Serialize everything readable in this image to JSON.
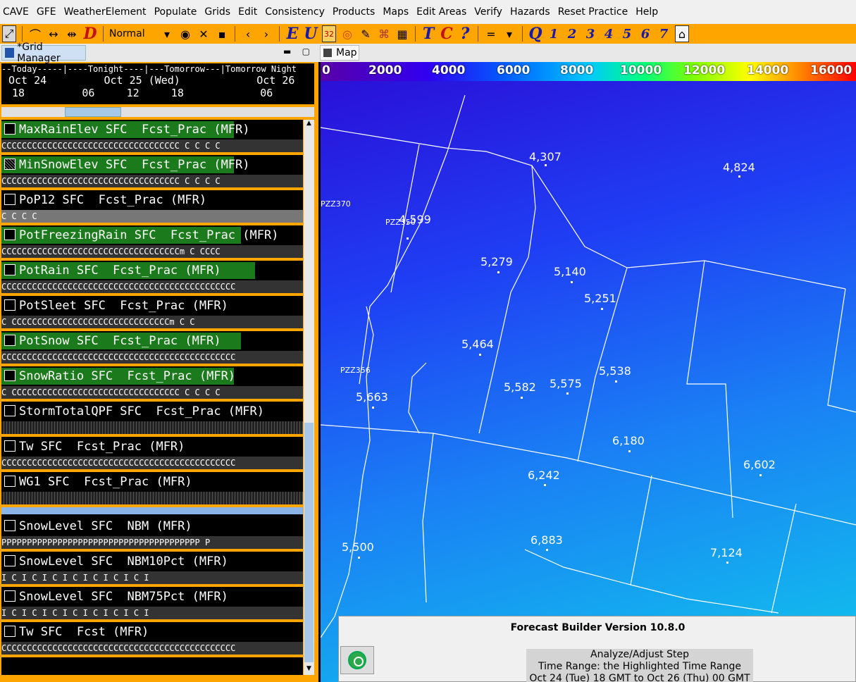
{
  "menu": [
    "CAVE",
    "GFE",
    "WeatherElement",
    "Populate",
    "Grids",
    "Edit",
    "Consistency",
    "Products",
    "Maps",
    "Edit Areas",
    "Verify",
    "Hazards",
    "Reset Practice",
    "Help"
  ],
  "toolbar": {
    "mode": "Normal",
    "edit_e": "E",
    "edit_u": "U",
    "t_tool": "T",
    "c_tool": "C",
    "q_tool": "Q",
    "help": "?",
    "equals": "=",
    "d_tool": "D",
    "badge": "32",
    "nums": [
      "1",
      "2",
      "3",
      "4",
      "5",
      "6",
      "7"
    ]
  },
  "grid_manager": {
    "tab_label": "*Grid Manager"
  },
  "timescale": {
    "periods": "--Today-----|----Tonight----|---Tomorrow---|Tomorrow Night",
    "dates": "Oct 24         Oct 25 (Wed)            Oct 26",
    "hours": " 18         06     12     18            06"
  },
  "grids": [
    {
      "title": "MaxRainElev SFC  Fcst_Prac (MFR)",
      "strip": "CCCCCCCCCCCCCCCCCCCCCCCCCCCCCCCCCCC C C C C"
    },
    {
      "title": "MinSnowElev SFC  Fcst_Prac (MFR)",
      "strip": "CCCCCCCCCCCCCCCCCCCCCCCCCCCCCCCCCCC C C C C"
    },
    {
      "title": "PoP12 SFC  Fcst_Prac (MFR)",
      "strip": "     C             C               C               C"
    },
    {
      "title": "PotFreezingRain SFC  Fcst_Prac (MFR)",
      "strip": "CCCCCCCCCCCCCCCCCCCCCCCCCCCCCCCCCCCm C CCCC"
    },
    {
      "title": "PotRain SFC  Fcst_Prac (MFR)",
      "strip": "CCCCCCCCCCCCCCCCCCCCCCCCCCCCCCCCCCCCCCCCCCCCCC"
    },
    {
      "title": "PotSleet SFC  Fcst_Prac (MFR)",
      "strip": "C CCCCCCCCCCCCCCCCCCCCCCCCCCCCCCCm   C   C"
    },
    {
      "title": "PotSnow SFC  Fcst_Prac (MFR)",
      "strip": "CCCCCCCCCCCCCCCCCCCCCCCCCCCCCCCCCCCCCCCCCCCCCC"
    },
    {
      "title": "SnowRatio SFC  Fcst_Prac (MFR)",
      "strip": "C CCCCCCCCCCCCCCCCCCCCCCCCCCCCCCCCC C C C C"
    },
    {
      "title": "StormTotalQPF SFC  Fcst_Prac (MFR)",
      "strip": ""
    },
    {
      "title": "Tw SFC  Fcst_Prac (MFR)",
      "strip": "CCCCCCCCCCCCCCCCCCCCCCCCCCCCCCCCCCCCCCCCCCCCCC"
    },
    {
      "title": "WG1 SFC  Fcst_Prac (MFR)",
      "strip": ""
    },
    {
      "title": "SnowLevel SFC  NBM (MFR)",
      "strip": "PPPPPPPPPPPPPPPPPPPPPPPPPPPPPPPPPPPPPPP  P"
    },
    {
      "title": "SnowLevel SFC  NBM10Pct (MFR)",
      "strip": " I  C  I  C  I  C  I  C  I  C  I  C  I  C  I"
    },
    {
      "title": "SnowLevel SFC  NBM75Pct (MFR)",
      "strip": " I  C  I  C  I  C  I  C  I  C  I  C  I  C  I"
    },
    {
      "title": "Tw SFC  Fcst (MFR)",
      "strip": "CCCCCCCCCCCCCCCCCCCCCCCCCCCCCCCCCCCCCCCCCCCCCC"
    }
  ],
  "map": {
    "tab_label": "Map",
    "colorbar_labels": [
      "0",
      "2000",
      "4000",
      "6000",
      "8000",
      "10000",
      "12000",
      "14000",
      "16000"
    ],
    "elevations": [
      {
        "label": "4,307"
      },
      {
        "label": "4,824"
      },
      {
        "label": "4,599"
      },
      {
        "label": "5,279"
      },
      {
        "label": "5,140"
      },
      {
        "label": "5,251"
      },
      {
        "label": "5,464"
      },
      {
        "label": "5,538"
      },
      {
        "label": "5,582"
      },
      {
        "label": "5,575"
      },
      {
        "label": "5,663"
      },
      {
        "label": "6,180"
      },
      {
        "label": "6,602"
      },
      {
        "label": "6,242"
      },
      {
        "label": "5,500"
      },
      {
        "label": "6,883"
      },
      {
        "label": "7,124"
      }
    ],
    "zones": [
      "PZZ370",
      "PZZ350",
      "PZZ356"
    ]
  },
  "forecast_builder": {
    "title": "Forecast Builder Version 10.8.0",
    "step": "Analyze/Adjust Step",
    "time_range": "Time Range:  the Highlighted Time Range",
    "dates": "Oct 24 (Tue) 18 GMT to Oct 26 (Thu) 00 GMT"
  }
}
